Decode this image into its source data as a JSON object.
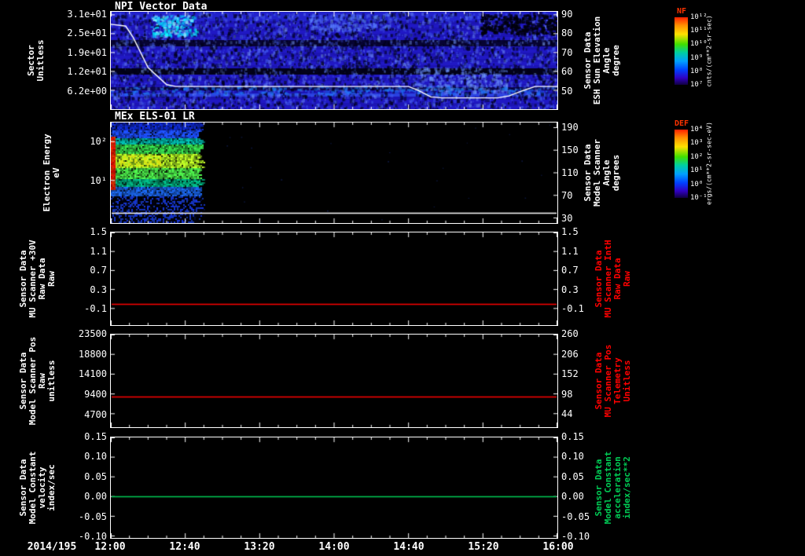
{
  "window": {
    "background": "#000000"
  },
  "xaxis": {
    "date": "2014/195",
    "ticks": [
      "12:00",
      "12:40",
      "13:20",
      "14:00",
      "14:40",
      "15:20",
      "16:00"
    ]
  },
  "panels": [
    {
      "title": "NPI Vector Data",
      "left_label": "Sector\nUnitless",
      "right_label": "Sensor Data\nESH Sun Elevation\nAngle\ndegree",
      "right_label_color": "#ffffff",
      "left_ticks": [
        "3.1e+01",
        "2.5e+01",
        "1.9e+01",
        "1.2e+01",
        "6.2e+00"
      ],
      "right_ticks": [
        "90",
        "80",
        "70",
        "60",
        "50"
      ]
    },
    {
      "title": "MEx ELS-01 LR",
      "left_label": "Electron Energy\neV",
      "right_label": "Sensor Data\nModel Scanner\nAngle\ndegrees",
      "right_label_color": "#ffffff",
      "left_ticks": [
        "10²",
        "10¹"
      ],
      "right_ticks": [
        "190",
        "150",
        "110",
        "70",
        "30"
      ]
    },
    {
      "title": "",
      "left_label": "Sensor Data\nMU Scanner +30V\nRaw Data\nRaw",
      "right_label": "Sensor Data\nMU Scanner IntH\nRaw Data\nRaw",
      "right_label_color": "#ff0000",
      "left_ticks": [
        "1.5",
        "1.1",
        "0.7",
        "0.3",
        "-0.1"
      ],
      "right_ticks": [
        "1.5",
        "1.1",
        "0.7",
        "0.3",
        "-0.1"
      ]
    },
    {
      "title": "",
      "left_label": "Sensor Data\nModel Scanner Pos\nRaw\nunitless",
      "right_label": "Sensor Data\nMU Scanner Pos\nTelemetry\nUnitless",
      "right_label_color": "#ff0000",
      "left_ticks": [
        "23500",
        "18800",
        "14100",
        "9400",
        "4700"
      ],
      "right_ticks": [
        "260",
        "206",
        "152",
        "98",
        "44"
      ]
    },
    {
      "title": "",
      "left_label": "Sensor Data\nModel Constant\nvelocity\nindex/sec",
      "right_label": "Sensor Data\nModel Constant\nacceleration\nindex/sec**2",
      "right_label_color": "#00cc55",
      "left_ticks": [
        "0.15",
        "0.10",
        "0.05",
        "0.00",
        "-0.05",
        "-0.10"
      ],
      "right_ticks": [
        "0.15",
        "0.10",
        "0.05",
        "0.00",
        "-0.05",
        "-0.10"
      ]
    }
  ],
  "colorbars": [
    {
      "title": "NF",
      "title_color": "#ff3300",
      "ticks": [
        "10¹²",
        "10¹¹",
        "10¹⁰",
        "10⁹",
        "10⁸",
        "10⁷"
      ],
      "unit": "cnts/(cm**2-sr-sec)"
    },
    {
      "title": "DEF",
      "title_color": "#ff3300",
      "ticks": [
        "10⁴",
        "10³",
        "10²",
        "10¹",
        "10⁰",
        "10⁻¹"
      ],
      "unit": "ergs/(cm**2-sr-sec-eV)"
    }
  ],
  "chart_data": [
    {
      "type": "heatmap",
      "panel": 1,
      "title": "NPI Vector Data",
      "ylabel": "Sector (Unitless)",
      "ylim": [
        0,
        32
      ],
      "y_ticks": [
        31,
        24.8,
        18.6,
        12.4,
        6.2
      ],
      "y_ticks_right": [
        90,
        80,
        70,
        60,
        50
      ],
      "ylim_right": [
        40,
        91.6
      ],
      "x_ticks": [
        "12:00",
        "12:40",
        "13:20",
        "14:00",
        "14:40",
        "15:20",
        "16:00"
      ],
      "x_range": [
        "2014/195 12:00",
        "2014/195 16:00"
      ],
      "colorbar": {
        "name": "NF",
        "unit": "cnts/(cm**2-sr-sec)",
        "range_log10": [
          7,
          12
        ]
      },
      "description": "Blue/violet sector-vs-time count spectrogram with dark sector bands, cyan enhancement near 12:05-12:15 in upper sectors, and a bright band near sector 5",
      "overlay_line": {
        "name": "Sensor Data ESH Sun Elevation Angle (degree)",
        "color": "#ffffff",
        "points_min_deg": [
          [
            0,
            85
          ],
          [
            8,
            84
          ],
          [
            12,
            78
          ],
          [
            20,
            62
          ],
          [
            30,
            53
          ],
          [
            35,
            52
          ],
          [
            160,
            52
          ],
          [
            165,
            50
          ],
          [
            172,
            46.5
          ],
          [
            178,
            46
          ],
          [
            208,
            46
          ],
          [
            214,
            47
          ],
          [
            222,
            50
          ],
          [
            228,
            52
          ],
          [
            240,
            52
          ]
        ]
      }
    },
    {
      "type": "heatmap",
      "panel": 2,
      "title": "MEx ELS-01 LR",
      "ylabel": "Electron Energy (eV)",
      "yscale": "log",
      "ylim": [
        0.8,
        310
      ],
      "y_ticks": [
        100,
        10
      ],
      "y_ticks_right": [
        190,
        150,
        110,
        70,
        30
      ],
      "ylim_right": [
        21,
        199
      ],
      "x_range": [
        "2014/195 12:00",
        "2014/195 16:00"
      ],
      "colorbar": {
        "name": "DEF",
        "unit": "ergs/(cm**2-sr-sec-eV)",
        "range_log10": [
          -1,
          4
        ]
      },
      "data_coverage": "Rainbow electron-flux spectrogram from 12:00 to about 12:50 only (green/yellow mid energies, red at left edge, blue high energies, dark low energies); remainder of interval has no data (black)",
      "overlay_line": {
        "name": "Sensor Data Model Scanner Angle (degrees)",
        "color": "#ffffff",
        "constant_value": 39
      }
    },
    {
      "type": "line",
      "panel": 3,
      "ylabel": "MU Scanner +30V Raw Data (Raw)",
      "ylim": [
        -0.45,
        1.5
      ],
      "y_ticks": [
        1.5,
        1.1,
        0.7,
        0.3,
        -0.1
      ],
      "y_ticks_right": [
        1.5,
        1.1,
        0.7,
        0.3,
        -0.1
      ],
      "ylim_right": [
        -0.45,
        1.5
      ],
      "x_range": [
        "2014/195 12:00",
        "2014/195 16:00"
      ],
      "series": [
        {
          "name": "Sensor Data MU Scanner IntH Raw Data Raw",
          "color": "#ff0000",
          "constant_value": 0.0
        }
      ]
    },
    {
      "type": "line",
      "panel": 4,
      "ylabel": "Model Scanner Pos Raw (unitless)",
      "ylim": [
        1500,
        23500
      ],
      "y_ticks": [
        23500,
        18800,
        14100,
        9400,
        4700
      ],
      "y_ticks_right": [
        260,
        206,
        152,
        98,
        44
      ],
      "ylim_right": [
        7,
        260
      ],
      "x_range": [
        "2014/195 12:00",
        "2014/195 16:00"
      ],
      "series": [
        {
          "name": "Sensor Data MU Scanner Pos Telemetry Unitless",
          "color": "#ff0000",
          "constant_value": 8700
        }
      ]
    },
    {
      "type": "line",
      "panel": 5,
      "ylabel": "Model Constant velocity (index/sec)",
      "ylim": [
        -0.105,
        0.15
      ],
      "y_ticks": [
        0.15,
        0.1,
        0.05,
        0.0,
        -0.05,
        -0.1
      ],
      "y_ticks_right": [
        0.15,
        0.1,
        0.05,
        0.0,
        -0.05,
        -0.1
      ],
      "ylim_right": [
        -0.105,
        0.15
      ],
      "x_range": [
        "2014/195 12:00",
        "2014/195 16:00"
      ],
      "series": [
        {
          "name": "Sensor Data Model Constant acceleration index/sec**2",
          "color": "#00cc55",
          "constant_value": 0.0
        }
      ]
    }
  ]
}
